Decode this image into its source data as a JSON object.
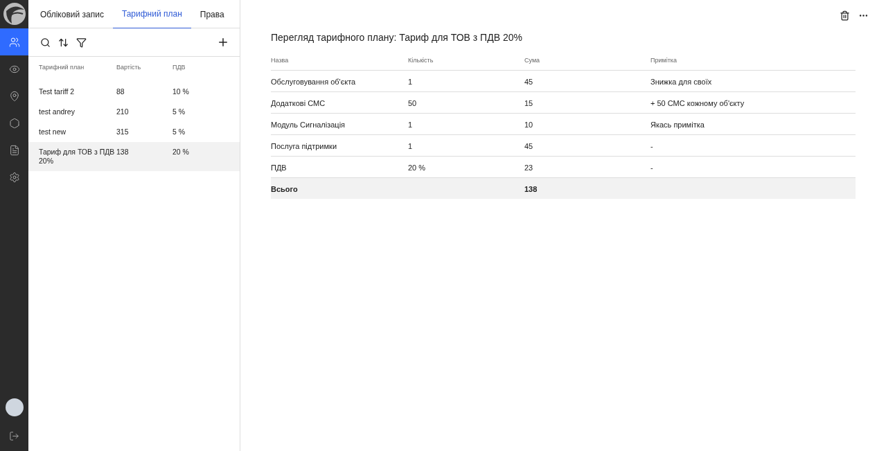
{
  "sidebar": {
    "items": [
      {
        "kind": "users",
        "selected": true
      },
      {
        "kind": "eye",
        "selected": false
      },
      {
        "kind": "pin",
        "selected": false
      },
      {
        "kind": "hexagon",
        "selected": false
      },
      {
        "kind": "document",
        "selected": false
      },
      {
        "kind": "settings",
        "selected": false
      }
    ]
  },
  "tabs": [
    {
      "label": "Обліковий запис",
      "selected": false
    },
    {
      "label": "Тарифний план",
      "selected": true
    },
    {
      "label": "Права",
      "selected": false
    }
  ],
  "list": {
    "columns": [
      "Тарифний план",
      "Вартість",
      "ПДВ"
    ],
    "rows": [
      {
        "cells": [
          "Test tariff 2",
          "88",
          "10 %"
        ],
        "selected": false
      },
      {
        "cells": [
          "test andrey",
          "210",
          "5 %"
        ],
        "selected": false
      },
      {
        "cells": [
          "test new",
          "315",
          "5 %"
        ],
        "selected": false
      },
      {
        "cells": [
          "Тариф для ТОВ з ПДВ 20%",
          "138",
          "20 %"
        ],
        "selected": true
      }
    ]
  },
  "detail": {
    "title": "Перегляд тарифного плану: Тариф для ТОВ з ПДВ 20%",
    "columns": [
      "Назва",
      "Кількість",
      "Сума",
      "Примітка"
    ],
    "rows": [
      [
        "Обслуговування об'єкта",
        "1",
        "45",
        "Знижка для своїх"
      ],
      [
        "Додаткові СМС",
        "50",
        "15",
        "+ 50 СМС кожному об'єкту"
      ],
      [
        "Модуль Сигналізація",
        "1",
        "10",
        "Якась примітка"
      ],
      [
        "Послуга підтримки",
        "1",
        "45",
        "-"
      ],
      [
        "ПДВ",
        "20 %",
        "23",
        "-"
      ]
    ],
    "total": {
      "label": "Всього",
      "sum": "138"
    }
  }
}
